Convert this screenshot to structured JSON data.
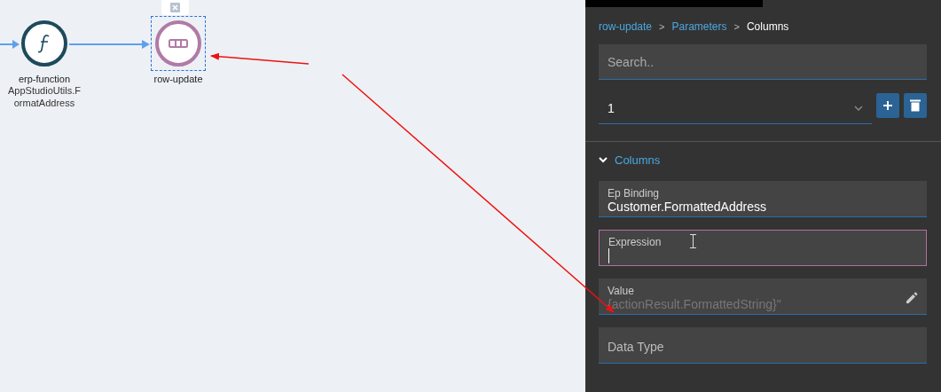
{
  "canvas": {
    "nodes": [
      {
        "kind": "function",
        "title": "erp-function",
        "subtitle": "AppStudioUtils.FormatAddress",
        "selected": false
      },
      {
        "kind": "row",
        "title": "row-update",
        "selected": true
      }
    ]
  },
  "panel": {
    "breadcrumb": [
      {
        "label": "row-update",
        "kind": "link"
      },
      {
        "separator": ">",
        "label": "Parameters",
        "kind": "link"
      },
      {
        "separator": ">",
        "label": "Columns",
        "kind": "current"
      }
    ],
    "search": {
      "placeholder": "Search.."
    },
    "select": {
      "value": "1"
    },
    "section": {
      "title": "Columns",
      "expanded": true
    },
    "fields": [
      {
        "kind": "text",
        "label": "Ep Binding",
        "value": "Customer.FormattedAddress",
        "focused": false
      },
      {
        "kind": "text",
        "label": "Expression",
        "focused": true
      },
      {
        "kind": "edit",
        "label": "Value",
        "placeholder": "{actionResult.FormattedString}\"",
        "focused": false
      },
      {
        "kind": "empty",
        "placeholder": "Data Type",
        "focused": false
      }
    ]
  }
}
